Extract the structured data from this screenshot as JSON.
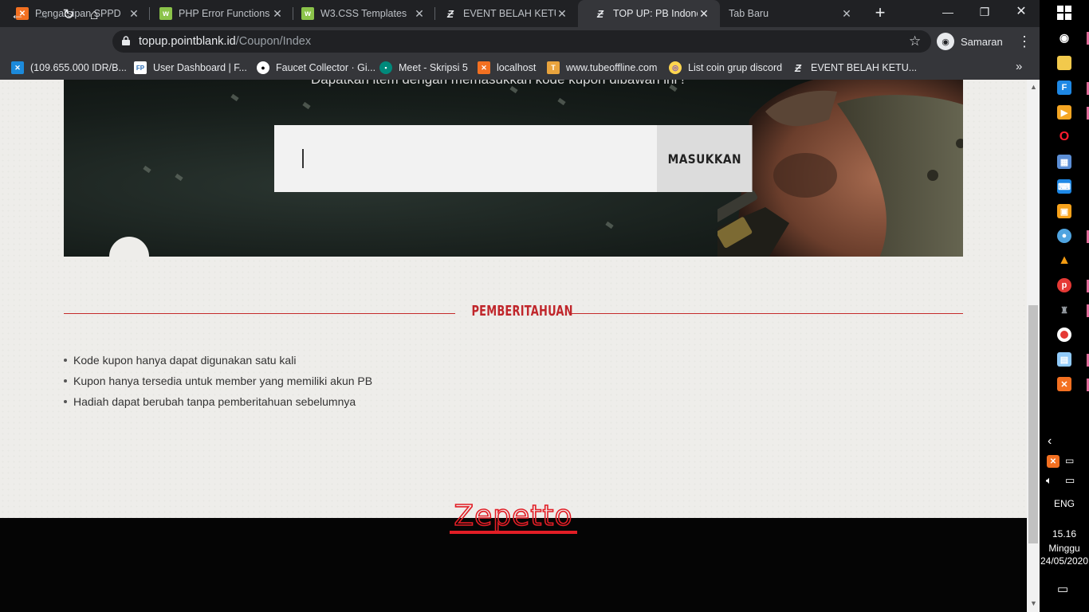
{
  "browser": {
    "tabs": [
      {
        "title": "Pengarsipan SPPD",
        "icon": "xampp-icon",
        "color": "#f37021",
        "active": false
      },
      {
        "title": "PHP Error Functions",
        "icon": "w3schools-icon",
        "color": "#8bc34a",
        "active": false
      },
      {
        "title": "W3.CSS Templates",
        "icon": "w3schools-icon",
        "color": "#8bc34a",
        "active": false
      },
      {
        "title": "EVENT BELAH KETUPAT",
        "icon": "zepetto-icon",
        "color": "#ffffff",
        "active": false
      },
      {
        "title": "TOP UP: PB Indonesia",
        "icon": "zepetto-icon",
        "color": "#ffffff",
        "active": true
      },
      {
        "title": "Tab Baru",
        "icon": "",
        "color": "",
        "active": false
      }
    ],
    "url_host": "topup.pointblank.id",
    "url_path": "/Coupon/Index",
    "profile_name": "Samaran",
    "bookmarks": [
      {
        "label": "(109.655.000 IDR/B...",
        "icon": "close-x-icon",
        "color": "#1c8adb"
      },
      {
        "label": "User Dashboard | F...",
        "icon": "fp-icon",
        "color": "#2d6fb7"
      },
      {
        "label": "Faucet Collector · Gi...",
        "icon": "github-icon",
        "color": "#ffffff"
      },
      {
        "label": "Meet - Skripsi 5",
        "icon": "meet-icon",
        "color": "#00897b"
      },
      {
        "label": "localhost",
        "icon": "xampp-icon",
        "color": "#f37021"
      },
      {
        "label": "www.tubeoffline.com",
        "icon": "tubeoffline-icon",
        "color": "#e8a33d"
      },
      {
        "label": "List coin grup discord",
        "icon": "coin-icon",
        "color": "#7e57c2"
      },
      {
        "label": "EVENT BELAH KETU...",
        "icon": "zepetto-icon",
        "color": "#ffffff"
      }
    ]
  },
  "page": {
    "hero_subtitle": "Dapatkan item dengan memasukkan kode kupon dibawah ini !",
    "coupon_input_value": "",
    "submit_label": "MASUKKAN",
    "notice_title": "PEMBERITAHUAN",
    "notice_items": [
      "Kode kupon hanya dapat digunakan satu kali",
      "Kupon hanya tersedia untuk member yang memiliki akun PB",
      "Hadiah dapat berubah tanpa pemberitahuan sebelumnya"
    ],
    "footer_logo": "Zepetto",
    "accent_color": "#c0262b"
  },
  "taskbar": {
    "language": "ENG",
    "time": "15.16",
    "day": "Minggu",
    "date": "24/05/2020"
  }
}
